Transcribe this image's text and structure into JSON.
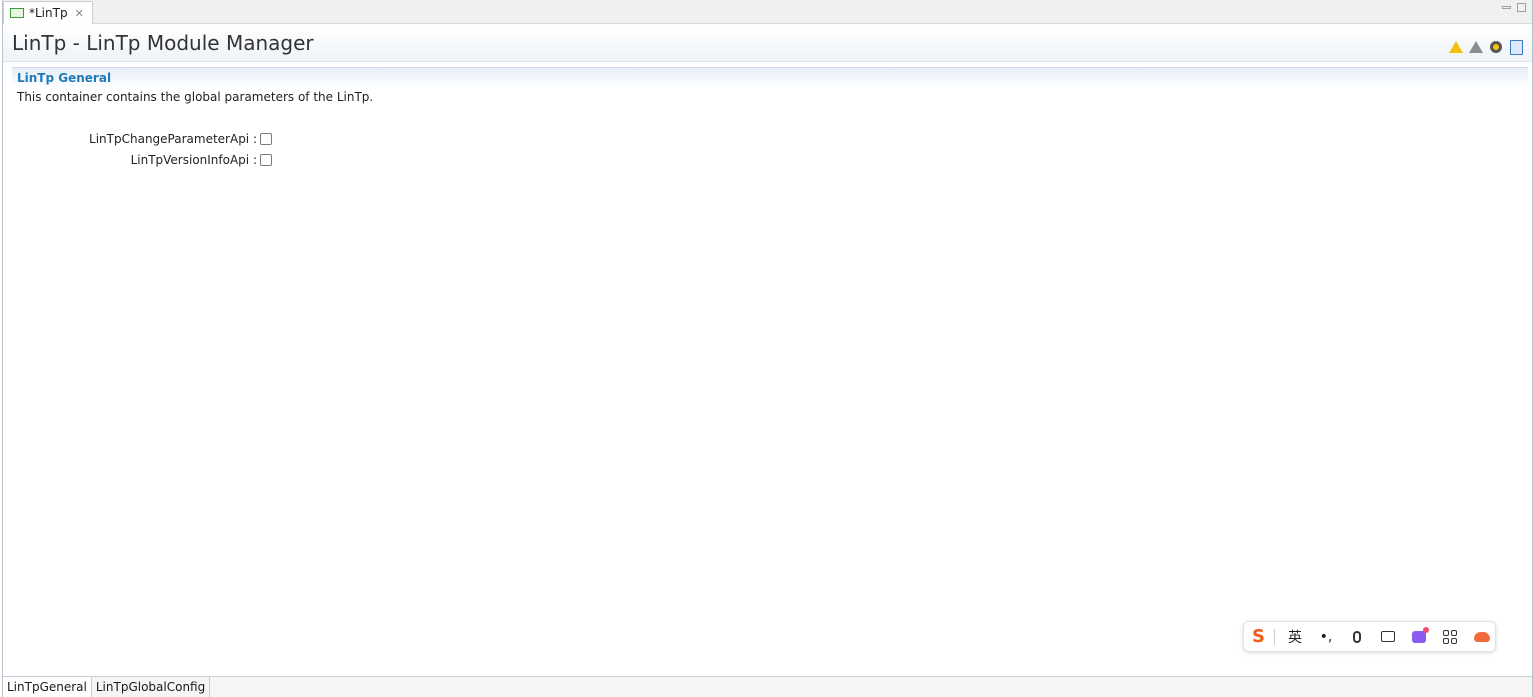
{
  "editor_tab": {
    "label": "*LinTp",
    "close_glyph": "✕"
  },
  "form": {
    "title": "LinTp - LinTp Module Manager",
    "header_tools": [
      "warning-icon",
      "warning-gray-icon",
      "validate-icon",
      "document-icon"
    ]
  },
  "section": {
    "title": "LinTp General",
    "description": "This container contains the global parameters of the LinTp.",
    "fields": [
      {
        "label": "LinTpChangeParameterApi :",
        "checked": false
      },
      {
        "label": "LinTpVersionInfoApi :",
        "checked": false
      }
    ]
  },
  "ime_toolbar": {
    "logo": "S",
    "language": "英",
    "punct": "•,"
  },
  "page_tabs": [
    {
      "label": "LinTpGeneral",
      "active": true
    },
    {
      "label": "LinTpGlobalConfig",
      "active": false
    }
  ]
}
